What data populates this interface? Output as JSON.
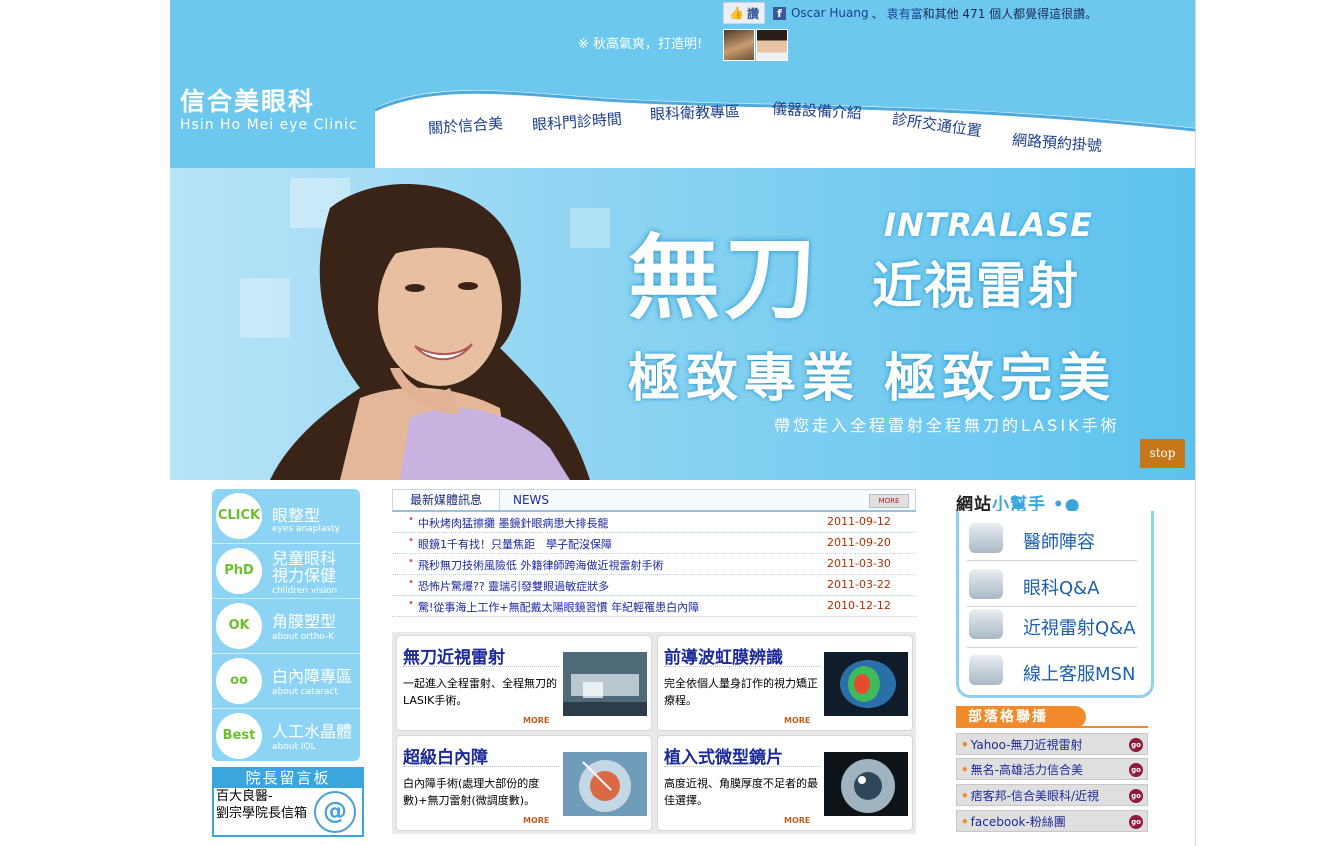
{
  "facebook": {
    "like_label": "讚",
    "name1": "Oscar Huang",
    "separator": "、",
    "name2": "袁有富",
    "text": "和其他 471 個人都覺得這很讚。"
  },
  "tagline": "※ 秋高氣爽，打造明!",
  "logo": {
    "zh": "信合美眼科",
    "en": "Hsin Ho Mei eye Clinic"
  },
  "nav": [
    "關於信合美",
    "眼科門診時間",
    "眼科衛教專區",
    "儀器設備介紹",
    "診所交通位置",
    "網路預約掛號"
  ],
  "banner": {
    "en": "INTRALASE",
    "big": "無刀",
    "mid": "近視雷射",
    "sub": "極致專業  極致完美",
    "foot": "帶您走入全程雷射全程無刀的LASIK手術",
    "stop": "stop"
  },
  "left_nav": [
    {
      "icon": "CLICK",
      "zh": "眼整型",
      "en": "eyes anaplasty"
    },
    {
      "icon": "PhD",
      "zh": "兒童眼科\n視力保健",
      "en": "children vision"
    },
    {
      "icon": "OK",
      "zh": "角膜塑型",
      "en": "about ortho-K"
    },
    {
      "icon": "oo",
      "zh": "白內障專區",
      "en": "about cataract"
    },
    {
      "icon": "Best",
      "zh": "人工水晶體",
      "en": "about IOL"
    }
  ],
  "board": {
    "title": "院長留言板",
    "line1": "百大良醫-",
    "line2": "劉宗學院長信箱"
  },
  "news": {
    "tab_active": "最新媒體訊息",
    "tab_other": "NEWS",
    "more": "MORE",
    "items": [
      {
        "title": "中秋烤肉猛擦攤 墨鏡針眼病患大排長龍",
        "date": "2011-09-12"
      },
      {
        "title": "眼鏡1千有找！只量焦距　學子配沒保障",
        "date": "2011-09-20"
      },
      {
        "title": "飛秒無刀技術風險低 外籍律師跨海做近視雷射手術",
        "date": "2011-03-30"
      },
      {
        "title": "恐怖片驚爆?? 靈瑞引發雙眼過敏症狀多",
        "date": "2011-03-22"
      },
      {
        "title": "驚!從事海上工作+無配戴太陽眼鏡習慣 年紀輕罹患白內障",
        "date": "2010-12-12"
      }
    ]
  },
  "features": [
    {
      "title": "無刀近視雷射",
      "desc": "一起進入全程雷射、全程無刀的LASIK手術。",
      "more": "MORE"
    },
    {
      "title": "前導波虹膜辨識",
      "desc": "完全依個人量身訂作的視力矯正療程。",
      "more": "MORE"
    },
    {
      "title": "超級白內障",
      "desc": "白內障手術(處理大部份的度數)+無刀雷射(微調度數)。",
      "more": "MORE"
    },
    {
      "title": "植入式微型鏡片",
      "desc": "高度近視、角膜厚度不足者的最佳選擇。",
      "more": "MORE"
    }
  ],
  "helper": {
    "title_a": "網站",
    "title_b": "小幫手",
    "items": [
      "醫師陣容",
      "眼科Q&A",
      "近視雷射Q&A",
      "線上客服MSN"
    ]
  },
  "blog": {
    "title": "部落格聯播",
    "items": [
      "Yahoo-無刀近視雷射",
      "無名-高雄活力信合美",
      "痞客邦-信合美眼科/近視",
      "facebook-粉絲團"
    ],
    "go": "go"
  }
}
